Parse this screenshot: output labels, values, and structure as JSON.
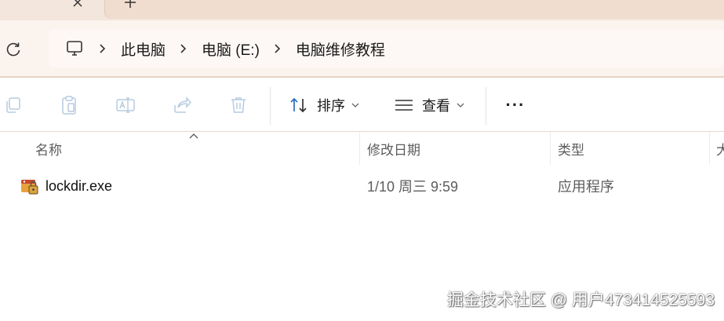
{
  "tabs": {
    "close_glyph": "✕",
    "new_tab_glyph": "+"
  },
  "address": {
    "refresh_icon": "refresh-icon",
    "computer_icon": "computer-icon",
    "crumbs": [
      "此电脑",
      "电脑 (E:)",
      "电脑维修教程"
    ],
    "separator_glyph": "›"
  },
  "toolbar": {
    "copy_icon": "copy-icon",
    "paste_icon": "paste-icon",
    "rename_icon": "rename-icon",
    "share_icon": "share-icon",
    "delete_icon": "delete-icon",
    "sort_label": "排序",
    "view_label": "查看",
    "more_label": "···"
  },
  "columns": {
    "name": "名称",
    "date": "修改日期",
    "type": "类型",
    "size_partial": "大"
  },
  "files": [
    {
      "name": "lockdir.exe",
      "date": "1/10 周三 9:59",
      "type": "应用程序",
      "icon": "app-lock-icon"
    }
  ],
  "watermark": "掘金技术社区 @ 用户473414525593",
  "colors": {
    "tab_strip": "#f3e6dc",
    "address_area": "#fbf3ee",
    "accent": "#2a6fbe"
  }
}
